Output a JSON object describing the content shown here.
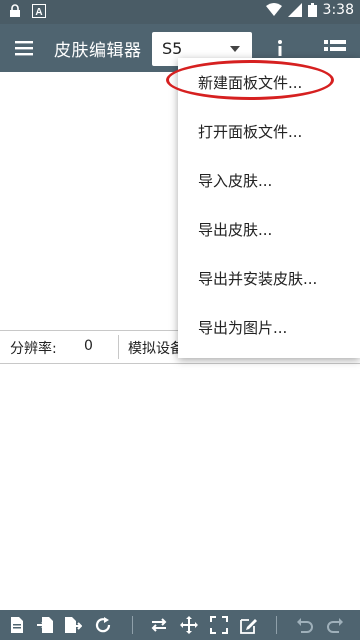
{
  "statusbar": {
    "time": "3:38"
  },
  "appbar": {
    "title": "皮肤编辑器",
    "selector_value": "S5"
  },
  "infobar": {
    "resolution_label": "分辨率:",
    "resolution_value": "0",
    "device_label": "模拟设备"
  },
  "menu": {
    "items": [
      {
        "label": "新建面板文件..."
      },
      {
        "label": "打开面板文件..."
      },
      {
        "label": "导入皮肤..."
      },
      {
        "label": "导出皮肤..."
      },
      {
        "label": "导出并安装皮肤..."
      },
      {
        "label": "导出为图片..."
      }
    ]
  },
  "icons": {
    "status_left": [
      "lock-icon",
      "font-a-icon"
    ],
    "status_right": [
      "wifi-icon",
      "signal-icon",
      "battery-icon"
    ],
    "bottom": [
      "new-file-icon",
      "import-icon",
      "export-icon",
      "refresh-icon",
      "swap-icon",
      "move-icon",
      "fullscreen-icon",
      "edit-icon",
      "undo-icon",
      "redo-icon"
    ]
  },
  "colors": {
    "statusbar": "#4a5c66",
    "appbar": "#4f6470",
    "highlight": "#d62020"
  }
}
